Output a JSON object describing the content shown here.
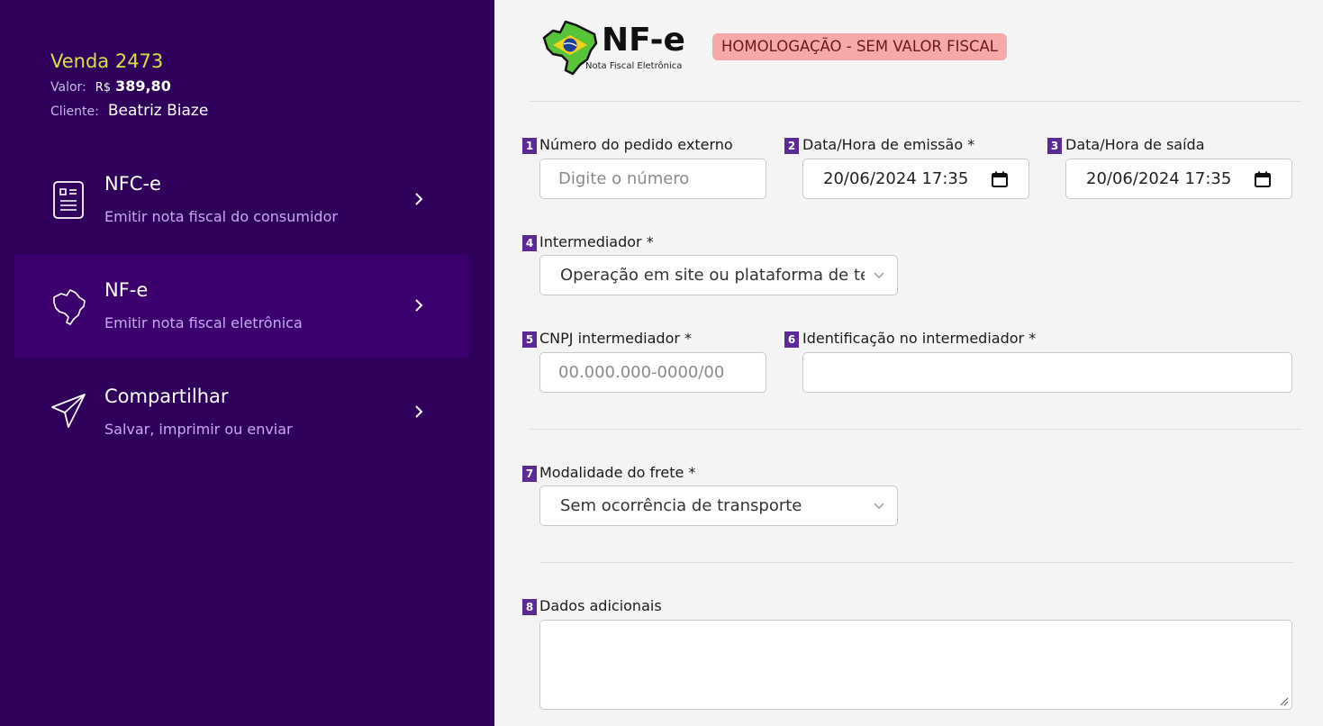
{
  "sale": {
    "title": "Venda 2473",
    "value_label": "Valor:",
    "currency": "R$",
    "value": "389,80",
    "client_label": "Cliente:",
    "client": "Beatriz Biaze"
  },
  "menu": [
    {
      "title": "NFC-e",
      "subtitle": "Emitir nota fiscal do consumidor",
      "icon": "receipt-icon",
      "active": false
    },
    {
      "title": "NF-e",
      "subtitle": "Emitir nota fiscal eletrônica",
      "icon": "brazil-map-icon",
      "active": true
    },
    {
      "title": "Compartilhar",
      "subtitle": "Salvar, imprimir ou enviar",
      "icon": "send-icon",
      "active": false
    }
  ],
  "header": {
    "logo_text": "NF-e",
    "logo_subtitle": "Nota Fiscal Eletrônica",
    "env_badge": "HOMOLOGAÇÃO - SEM VALOR FISCAL"
  },
  "form": {
    "f1": {
      "num": "1",
      "label": "Número do pedido externo",
      "placeholder": "Digite o número",
      "value": ""
    },
    "f2": {
      "num": "2",
      "label": "Data/Hora de emissão *",
      "value": "20/06/2024 17:35"
    },
    "f3": {
      "num": "3",
      "label": "Data/Hora de saída",
      "value": "20/06/2024 17:35"
    },
    "f4": {
      "num": "4",
      "label": "Intermediador *",
      "value": "Operação em site ou plataforma de terceiros"
    },
    "f5": {
      "num": "5",
      "label": "CNPJ intermediador *",
      "placeholder": "00.000.000-0000/00",
      "value": ""
    },
    "f6": {
      "num": "6",
      "label": "Identificação no intermediador *",
      "value": ""
    },
    "f7": {
      "num": "7",
      "label": "Modalidade do frete *",
      "value": "Sem ocorrência de transporte"
    },
    "f8": {
      "num": "8",
      "label": "Dados adicionais",
      "value": ""
    }
  },
  "colors": {
    "sidebar_bg": "#2e005c",
    "sidebar_active": "#3b006e",
    "sale_title": "#d5e04a",
    "menu_subtitle": "#c7a7f5",
    "field_number_bg": "#5b2a96",
    "env_badge_bg": "#f7a8a8"
  }
}
